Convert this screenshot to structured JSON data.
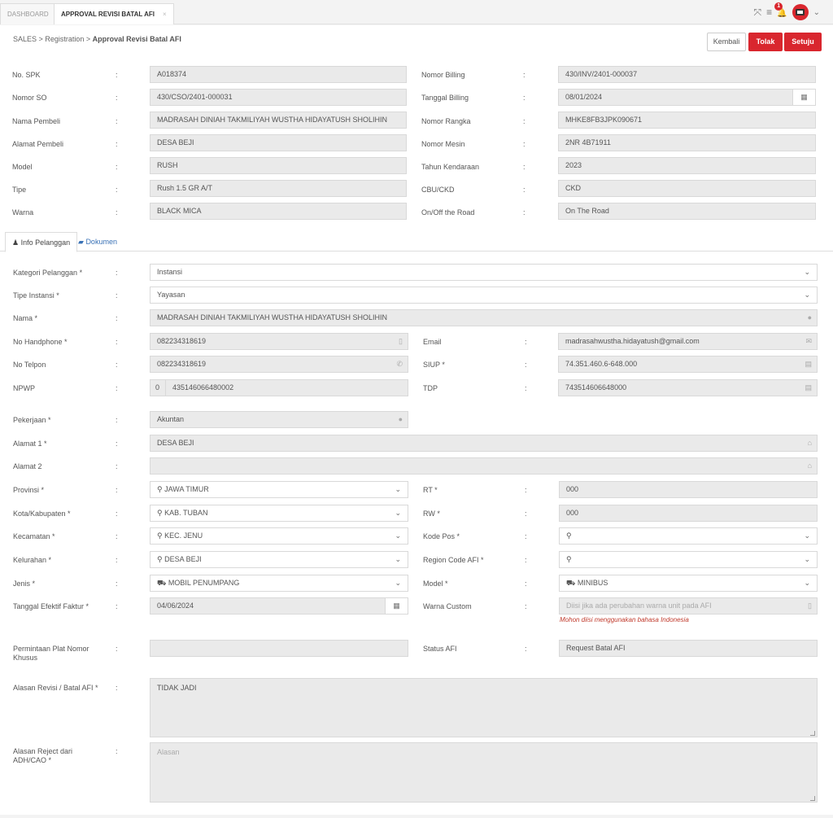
{
  "tabs": {
    "dashboard": "DASHBOARD",
    "approval": "APPROVAL REVISI BATAL AFI",
    "close": "×"
  },
  "notifications": {
    "count": "1"
  },
  "breadcrumb": {
    "sales": "SALES",
    "sep1": ">",
    "registration": "Registration",
    "sep2": ">",
    "current": "Approval Revisi Batal AFI"
  },
  "buttons": {
    "kembali": "Kembali",
    "tolak": "Tolak",
    "setuju": "Setuju"
  },
  "colon": ":",
  "spk": {
    "no_spk": {
      "label": "No. SPK",
      "value": "A018374"
    },
    "nomor_so": {
      "label": "Nomor SO",
      "value": "430/CSO/2401-000031"
    },
    "nama_pembeli": {
      "label": "Nama Pembeli",
      "value": "MADRASAH DINIAH TAKMILIYAH WUSTHA HIDAYATUSH SHOLIHIN"
    },
    "alamat_pembeli": {
      "label": "Alamat Pembeli",
      "value": "DESA BEJI"
    },
    "model": {
      "label": "Model",
      "value": "RUSH"
    },
    "tipe": {
      "label": "Tipe",
      "value": "Rush 1.5 GR A/T"
    },
    "warna": {
      "label": "Warna",
      "value": "BLACK MICA"
    },
    "nomor_billing": {
      "label": "Nomor Billing",
      "value": "430/INV/2401-000037"
    },
    "tanggal_billing": {
      "label": "Tanggal Billing",
      "value": "08/01/2024"
    },
    "nomor_rangka": {
      "label": "Nomor Rangka",
      "value": "MHKE8FB3JPK090671"
    },
    "nomor_mesin": {
      "label": "Nomor Mesin",
      "value": "2NR 4B71911"
    },
    "tahun_kendaraan": {
      "label": "Tahun Kendaraan",
      "value": "2023"
    },
    "cbu_ckd": {
      "label": "CBU/CKD",
      "value": "CKD"
    },
    "on_off_road": {
      "label": "On/Off the Road",
      "value": "On The Road"
    }
  },
  "section_tabs": {
    "info": "Info Pelanggan",
    "dokumen": "Dokumen"
  },
  "customer": {
    "kategori": {
      "label": "Kategori Pelanggan *",
      "value": "Instansi"
    },
    "tipe_instansi": {
      "label": "Tipe Instansi *",
      "value": "Yayasan"
    },
    "nama": {
      "label": "Nama *",
      "value": "MADRASAH DINIAH TAKMILIYAH WUSTHA HIDAYATUSH SHOLIHIN"
    },
    "no_hp": {
      "label": "No Handphone *",
      "value": "082234318619"
    },
    "email": {
      "label": "Email",
      "value": "madrasahwustha.hidayatush@gmail.com"
    },
    "no_telpon": {
      "label": "No Telpon",
      "value": "082234318619"
    },
    "siup": {
      "label": "SIUP *",
      "value": "74.351.460.6-648.000"
    },
    "npwp": {
      "label": "NPWP",
      "prefix": "0",
      "value": "435146066480002"
    },
    "tdp": {
      "label": "TDP",
      "value": "743514606648000"
    },
    "pekerjaan": {
      "label": "Pekerjaan *",
      "value": "Akuntan"
    },
    "alamat1": {
      "label": "Alamat 1 *",
      "value": "DESA BEJI"
    },
    "alamat2": {
      "label": "Alamat 2",
      "value": ""
    },
    "provinsi": {
      "label": "Provinsi *",
      "value": "JAWA TIMUR"
    },
    "kota": {
      "label": "Kota/Kabupaten *",
      "value": "KAB. TUBAN"
    },
    "kecamatan": {
      "label": "Kecamatan *",
      "value": "KEC. JENU"
    },
    "kelurahan": {
      "label": "Kelurahan *",
      "value": "DESA BEJI"
    },
    "jenis": {
      "label": "Jenis *",
      "value": "MOBIL PENUMPANG"
    },
    "tanggal_efektif": {
      "label": "Tanggal Efektif Faktur *",
      "value": "04/06/2024"
    },
    "rt": {
      "label": "RT *",
      "value": "000"
    },
    "rw": {
      "label": "RW *",
      "value": "000"
    },
    "kode_pos": {
      "label": "Kode Pos *",
      "value": ""
    },
    "region_code": {
      "label": "Region Code AFI *",
      "value": ""
    },
    "model": {
      "label": "Model *",
      "value": "MINIBUS"
    },
    "warna_custom": {
      "label": "Warna Custom",
      "placeholder": "Diisi jika ada perubahan warna unit pada AFI",
      "hint": "Mohon diisi menggunakan bahasa Indonesia"
    },
    "plat_nomor": {
      "label_line1": "Permintaan Plat Nomor",
      "label_line2": "Khusus",
      "value": ""
    },
    "status_afi": {
      "label": "Status AFI",
      "value": "Request Batal AFI"
    },
    "alasan_revisi": {
      "label": "Alasan Revisi / Batal AFI *",
      "value": "TIDAK JADI"
    },
    "alasan_reject": {
      "label_line1": "Alasan Reject dari",
      "label_line2": "ADH/CAO *",
      "placeholder": "Alasan"
    }
  },
  "icons": {
    "expand": "⤧",
    "menu": "≡",
    "bell": "🔔",
    "chevron": "⌄",
    "calendar": "▦",
    "user": "●",
    "phone": "▯",
    "phone_handset": "✆",
    "envelope": "✉",
    "card": "▤",
    "home": "⌂",
    "marker": "⚲",
    "car": "⛟",
    "mobile": "▯",
    "folder": "▰",
    "user_small": "♟"
  },
  "colors": {
    "accent": "#d9262e",
    "link": "#3a72b6"
  }
}
